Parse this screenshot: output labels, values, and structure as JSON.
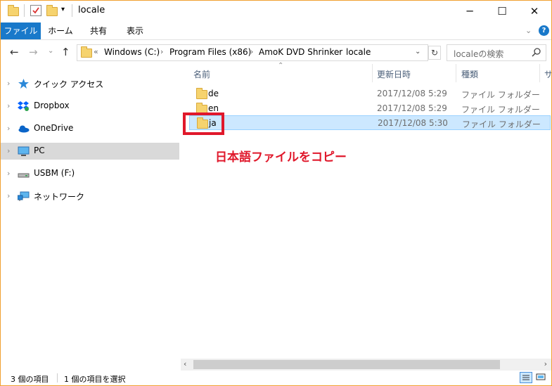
{
  "title_bar": {
    "title": "locale",
    "minimize": "─",
    "maximize": "☐",
    "close": "✕"
  },
  "ribbon": {
    "tabs": [
      "ファイル",
      "ホーム",
      "共有",
      "表示"
    ]
  },
  "address_bar": {
    "crumbs": [
      "Windows (C:)",
      "Program Files (x86)",
      "AmoK DVD Shrinker",
      "locale"
    ],
    "overflow": "«",
    "search_placeholder": "localeの検索"
  },
  "nav_pane": {
    "items": [
      {
        "label": "クイック アクセス",
        "icon": "star-icon"
      },
      {
        "label": "Dropbox",
        "icon": "dropbox-icon"
      },
      {
        "label": "OneDrive",
        "icon": "cloud-icon"
      },
      {
        "label": "PC",
        "icon": "monitor-icon",
        "selected": true
      },
      {
        "label": "USBM (F:)",
        "icon": "drive-icon"
      },
      {
        "label": "ネットワーク",
        "icon": "network-icon"
      }
    ]
  },
  "file_list": {
    "columns": [
      "名前",
      "更新日時",
      "種類",
      "サ"
    ],
    "rows": [
      {
        "name": "de",
        "date": "2017/12/08 5:29",
        "type": "ファイル フォルダー"
      },
      {
        "name": "en",
        "date": "2017/12/08 5:29",
        "type": "ファイル フォルダー"
      },
      {
        "name": "ja",
        "date": "2017/12/08 5:30",
        "type": "ファイル フォルダー",
        "selected": true
      }
    ]
  },
  "annotation": {
    "text": "日本語ファイルをコピー",
    "color": "#e0182b"
  },
  "status_bar": {
    "item_count": "3 個の項目",
    "selected_count": "1 個の項目を選択"
  },
  "colors": {
    "accent": "#1979ca",
    "window_border": "#f0a030",
    "selection": "#cce8ff"
  }
}
